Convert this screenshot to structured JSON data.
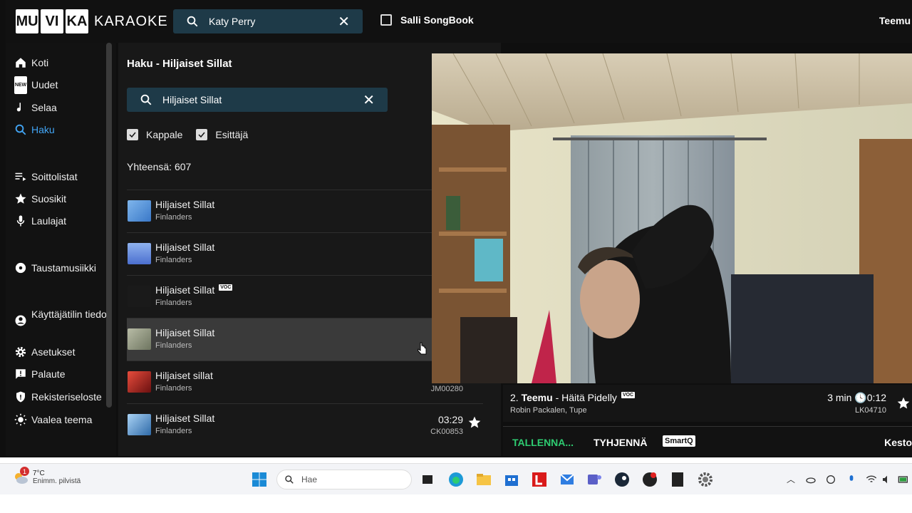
{
  "app": {
    "logo_boxes": [
      "MU",
      "VI",
      "KA"
    ],
    "logo_word": "KARAOKE",
    "top_search_value": "Katy Perry",
    "salli_label": "Salli SongBook",
    "user_name": "Teemu"
  },
  "sidebar": {
    "items": [
      {
        "label": "Koti",
        "icon": "home-icon"
      },
      {
        "label": "Uudet",
        "icon": "new-icon"
      },
      {
        "label": "Selaa",
        "icon": "music-note-icon"
      },
      {
        "label": "Haku",
        "icon": "search-icon",
        "active": true
      },
      {
        "label": "Soittolistat",
        "icon": "playlist-icon"
      },
      {
        "label": "Suosikit",
        "icon": "star-icon"
      },
      {
        "label": "Laulajat",
        "icon": "microphone-icon"
      },
      {
        "label": "Taustamusiikki",
        "icon": "disc-icon"
      },
      {
        "label": "Käyttäjätilin tiedot",
        "icon": "account-icon"
      },
      {
        "label": "Asetukset",
        "icon": "gear-icon"
      },
      {
        "label": "Palaute",
        "icon": "feedback-icon"
      },
      {
        "label": "Rekisteriseloste",
        "icon": "shield-icon"
      },
      {
        "label": "Vaalea teema",
        "icon": "sun-icon"
      }
    ],
    "new_badge": "NEW"
  },
  "main": {
    "title": "Haku - Hiljaiset Sillat",
    "search_value": "Hiljaiset Sillat",
    "filter_song": "Kappale",
    "filter_artist": "Esittäjä",
    "total": "Yhteensä: 607",
    "results": [
      {
        "title": "Hiljaiset Sillat",
        "artist": "Finlanders",
        "voc": false,
        "thumb_color": "#4a90d9"
      },
      {
        "title": "Hiljaiset Sillat",
        "artist": "Finlanders",
        "voc": false,
        "thumb_color": "#5b7fd6"
      },
      {
        "title": "Hiljaiset Sillat",
        "artist": "Finlanders",
        "voc": true,
        "thumb_color": "#202020"
      },
      {
        "title": "Hiljaiset Sillat",
        "artist": "Finlanders",
        "voc": false,
        "thumb_color": "#9aa08a"
      },
      {
        "title": "Hiljaiset sillat",
        "artist": "Finlanders",
        "voc": false,
        "thumb_color": "#c0392b",
        "code": "JM00280"
      },
      {
        "title": "Hiljaiset Sillat",
        "artist": "Finlanders",
        "voc": false,
        "thumb_color": "#3d7ab8",
        "duration": "03:29",
        "code": "CK00853"
      }
    ],
    "voc_label": "VOC"
  },
  "now_playing": {
    "number": "2.",
    "singer": "Teemu",
    "song": "- Häitä Pidelly",
    "voc_label": "VOC",
    "authors": "Robin Packalen, Tupe",
    "time": "3 min",
    "time_left": "0:12",
    "code": "LK04710"
  },
  "controls": {
    "save": "TALLENNA...",
    "clear": "TYHJENNÄ",
    "smartq": "SmartQ",
    "duration": "Kesto"
  },
  "taskbar": {
    "weather_badge": "1",
    "temp": "7°C",
    "weather": "Enimm. pilvistä",
    "search_placeholder": "Hae"
  }
}
